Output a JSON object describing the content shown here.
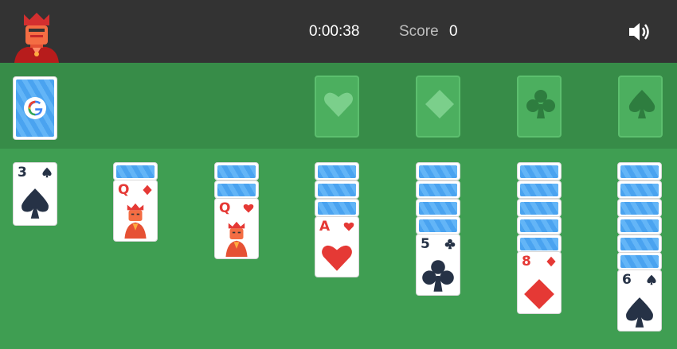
{
  "header": {
    "timer": "0:00:38",
    "score_label": "Score",
    "score_value": "0",
    "sound_icon": "speaker-icon"
  },
  "stock": {
    "logo_letter": "G"
  },
  "foundations": [
    {
      "suit": "hearts"
    },
    {
      "suit": "diamonds"
    },
    {
      "suit": "clubs"
    },
    {
      "suit": "spades"
    }
  ],
  "tableau": [
    {
      "hidden": 0,
      "face": {
        "rank": "3",
        "suit": "spades",
        "color": "black"
      }
    },
    {
      "hidden": 1,
      "face": {
        "rank": "Q",
        "suit": "diamonds",
        "color": "red"
      }
    },
    {
      "hidden": 2,
      "face": {
        "rank": "Q",
        "suit": "hearts",
        "color": "red"
      }
    },
    {
      "hidden": 3,
      "face": {
        "rank": "A",
        "suit": "hearts",
        "color": "red"
      }
    },
    {
      "hidden": 4,
      "face": {
        "rank": "5",
        "suit": "clubs",
        "color": "black"
      }
    },
    {
      "hidden": 5,
      "face": {
        "rank": "8",
        "suit": "diamonds",
        "color": "red"
      }
    },
    {
      "hidden": 6,
      "face": {
        "rank": "6",
        "suit": "spades",
        "color": "black"
      }
    }
  ],
  "colors": {
    "felt": "#3f9e52",
    "topbar": "#333333",
    "red": "#e53935",
    "black": "#263246"
  }
}
